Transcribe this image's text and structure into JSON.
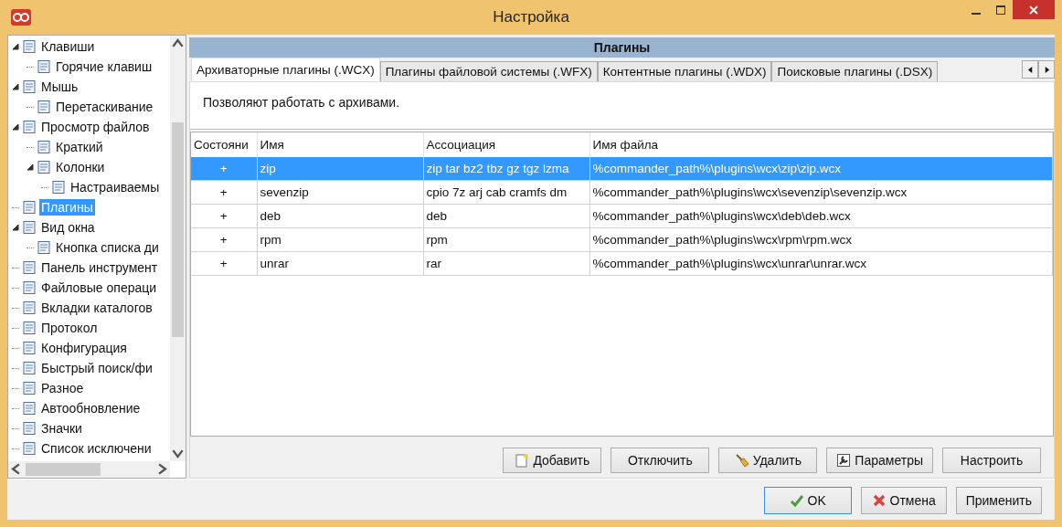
{
  "window": {
    "title": "Настройка"
  },
  "tree": [
    {
      "label": "Клавиши",
      "selected": false,
      "expanded": true,
      "children": [
        {
          "label": "Горячие клавиш",
          "selected": false
        }
      ]
    },
    {
      "label": "Мышь",
      "selected": false,
      "expanded": true,
      "children": [
        {
          "label": "Перетаскивание",
          "selected": false
        }
      ]
    },
    {
      "label": "Просмотр файлов",
      "selected": false,
      "expanded": true,
      "children": [
        {
          "label": "Краткий",
          "selected": false
        },
        {
          "label": "Колонки",
          "selected": false,
          "expanded": true,
          "children": [
            {
              "label": "Настраиваемы",
              "selected": false
            }
          ]
        }
      ]
    },
    {
      "label": "Плагины",
      "selected": true
    },
    {
      "label": "Вид окна",
      "selected": false,
      "expanded": true,
      "children": [
        {
          "label": "Кнопка списка ди",
          "selected": false
        }
      ]
    },
    {
      "label": "Панель инструмент",
      "selected": false
    },
    {
      "label": "Файловые операци",
      "selected": false
    },
    {
      "label": "Вкладки каталогов",
      "selected": false
    },
    {
      "label": "Протокол",
      "selected": false
    },
    {
      "label": "Конфигурация",
      "selected": false
    },
    {
      "label": "Быстрый поиск/фи",
      "selected": false
    },
    {
      "label": "Разное",
      "selected": false
    },
    {
      "label": "Автообновление",
      "selected": false
    },
    {
      "label": "Значки",
      "selected": false
    },
    {
      "label": "Список исключени",
      "selected": false
    }
  ],
  "section_title": "Плагины",
  "tabs": [
    {
      "label": "Архиваторные плагины (.WCX)",
      "selected": true
    },
    {
      "label": "Плагины файловой системы (.WFX)",
      "selected": false
    },
    {
      "label": "Контентные плагины (.WDX)",
      "selected": false
    },
    {
      "label": "Поисковые плагины (.DSX)",
      "selected": false
    }
  ],
  "description": "Позволяют работать с архивами.",
  "table": {
    "columns": [
      "Состояни",
      "Имя",
      "Ассоциация",
      "Имя файла"
    ],
    "rows": [
      {
        "state": "+",
        "name": "zip",
        "association": "zip tar bz2 tbz gz tgz lzma",
        "file": "%commander_path%\\plugins\\wcx\\zip\\zip.wcx",
        "selected": true
      },
      {
        "state": "+",
        "name": "sevenzip",
        "association": "cpio 7z arj cab cramfs dm",
        "file": "%commander_path%\\plugins\\wcx\\sevenzip\\sevenzip.wcx",
        "selected": false
      },
      {
        "state": "+",
        "name": "deb",
        "association": "deb",
        "file": "%commander_path%\\plugins\\wcx\\deb\\deb.wcx",
        "selected": false
      },
      {
        "state": "+",
        "name": "rpm",
        "association": "rpm",
        "file": "%commander_path%\\plugins\\wcx\\rpm\\rpm.wcx",
        "selected": false
      },
      {
        "state": "+",
        "name": "unrar",
        "association": "rar",
        "file": "%commander_path%\\plugins\\wcx\\unrar\\unrar.wcx",
        "selected": false
      }
    ]
  },
  "plugin_buttons": [
    {
      "label": "Добавить",
      "kind": "add"
    },
    {
      "label": "Отключить",
      "kind": "plain"
    },
    {
      "label": "Удалить",
      "kind": "remove"
    },
    {
      "label": "Параметры",
      "kind": "params"
    },
    {
      "label": "Настроить",
      "kind": "plain"
    }
  ],
  "dialog_buttons": [
    {
      "label": "OK",
      "kind": "ok",
      "default": true
    },
    {
      "label": "Отмена",
      "kind": "cancel",
      "default": false
    },
    {
      "label": "Применить",
      "kind": "plain",
      "default": false
    }
  ]
}
